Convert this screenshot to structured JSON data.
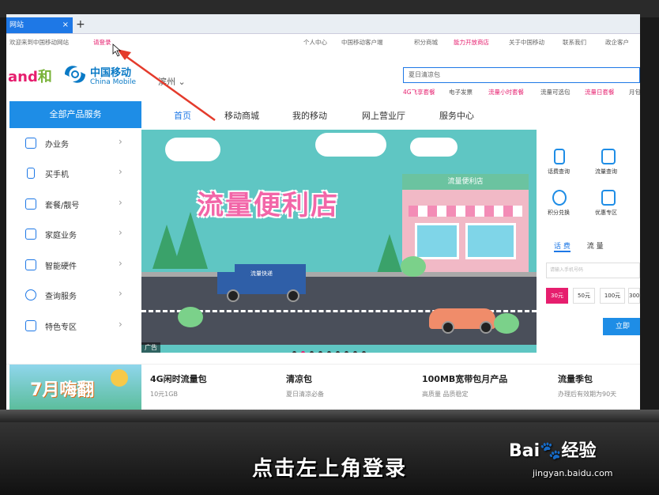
{
  "browser": {
    "tab_title": "网站",
    "tab_close": "×",
    "new_tab": "+"
  },
  "topnav": {
    "welcome": "欢迎来到中国移动网站",
    "login": "请登录",
    "personal": "个人中心",
    "client": "中国移动客户端",
    "points_mall": "积分商城",
    "open_store": "能力开放商店",
    "about": "关于中国移动",
    "contact": "联系我们",
    "gov": "政企客户"
  },
  "header": {
    "logo_and": "and",
    "logo_he": "和",
    "logo_cn": "中国移动",
    "logo_en": "China Mobile",
    "city": "滨州 ⌄",
    "search_placeholder": "夏日清凉包",
    "hot_links": [
      "4G飞享套餐",
      "电子发票",
      "流量小时套餐",
      "流量可选包",
      "流量日套餐",
      "月包"
    ]
  },
  "nav": {
    "all_products": "全部产品服务",
    "items": [
      "首页",
      "移动商城",
      "我的移动",
      "网上营业厅",
      "服务中心"
    ]
  },
  "sidebar": {
    "items": [
      {
        "label": "办业务",
        "icon": "briefcase-icon"
      },
      {
        "label": "买手机",
        "icon": "phone-icon"
      },
      {
        "label": "套餐/靓号",
        "icon": "sim-card-icon"
      },
      {
        "label": "家庭业务",
        "icon": "home-icon"
      },
      {
        "label": "智能硬件",
        "icon": "smart-device-icon"
      },
      {
        "label": "查询服务",
        "icon": "user-search-icon"
      },
      {
        "label": "特色专区",
        "icon": "feature-icon"
      }
    ],
    "arrow": "›"
  },
  "banner": {
    "title": "流量便利店",
    "store_sign": "流量便利店",
    "truck_label": "流量快递",
    "ad_tag": "广告",
    "dot_count": 9,
    "active_dot": 1
  },
  "quick_panel": {
    "items": [
      {
        "label": "话费查询",
        "icon": "bill-icon"
      },
      {
        "label": "流量查询",
        "icon": "chart-icon"
      },
      {
        "label": "积分兑换",
        "icon": "refresh-icon"
      },
      {
        "label": "优惠专区",
        "icon": "gift-icon"
      }
    ],
    "tabs": [
      "话 费",
      "流 量"
    ],
    "phone_placeholder": "请输入手机号码",
    "amounts": [
      "30元",
      "50元",
      "100元",
      "300"
    ],
    "buy_label": "立即"
  },
  "products": {
    "promo_text": "7月嗨翻",
    "items": [
      {
        "title": "4G闲时流量包",
        "sub": "10元1GB"
      },
      {
        "title": "清凉包",
        "sub": "夏日清凉必备"
      },
      {
        "title": "100MB宽带包月产品",
        "sub": "高质量 品质稳定"
      },
      {
        "title": "流量季包",
        "sub": "办理后有效期为90天"
      }
    ]
  },
  "overlay": {
    "caption": "点击左上角登录",
    "watermark_logo": "Bai🐾经验",
    "watermark_url": "jingyan.baidu.com"
  },
  "colors": {
    "brand_blue": "#1e78e6",
    "brand_pink": "#e61e6e",
    "banner_bg": "#5fc6c3"
  }
}
